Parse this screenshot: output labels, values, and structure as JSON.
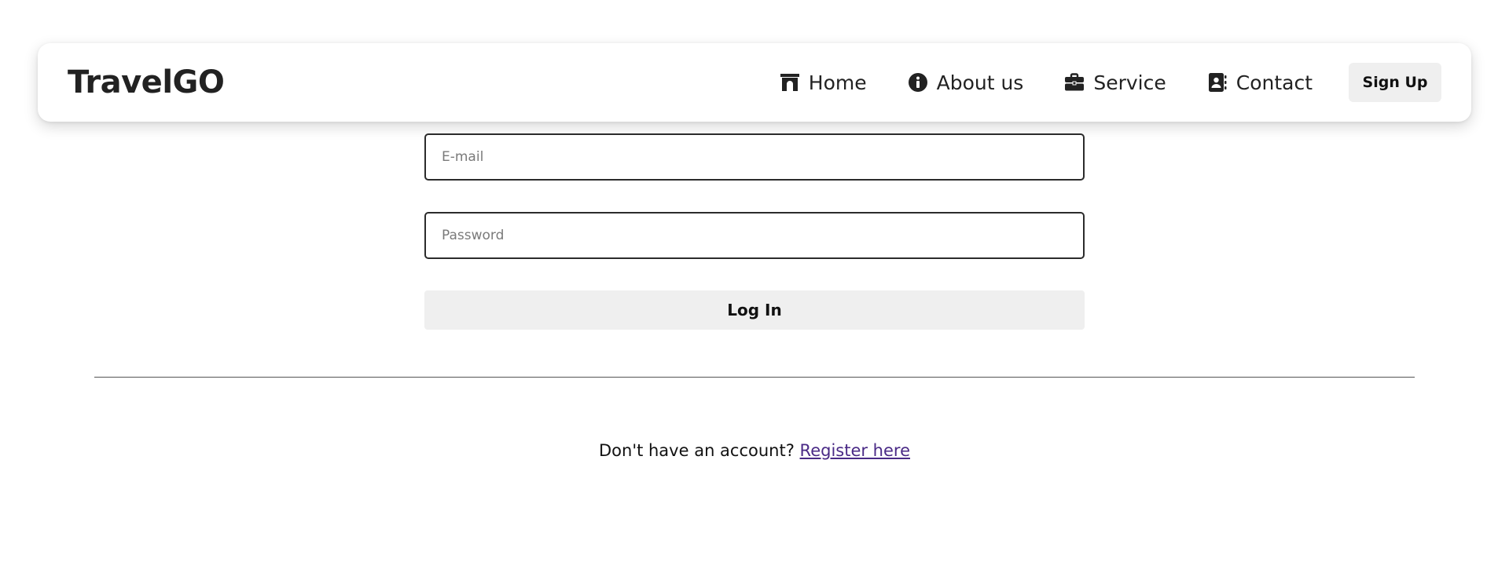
{
  "navbar": {
    "brand": "TravelGO",
    "links": [
      {
        "label": "Home",
        "icon": "archway-icon"
      },
      {
        "label": "About us",
        "icon": "info-circle-icon"
      },
      {
        "label": "Service",
        "icon": "briefcase-icon"
      },
      {
        "label": "Contact",
        "icon": "address-book-icon"
      }
    ],
    "signup_label": "Sign Up"
  },
  "form": {
    "email_placeholder": "E-mail",
    "email_value": "",
    "password_placeholder": "Password",
    "password_value": "",
    "login_label": "Log In"
  },
  "footer": {
    "prompt": "Don't have an account?",
    "register_label": "Register here"
  },
  "colors": {
    "text": "#222222",
    "button_bg": "#efefef",
    "link": "#4a2a86",
    "input_border": "#2b2b2b"
  }
}
